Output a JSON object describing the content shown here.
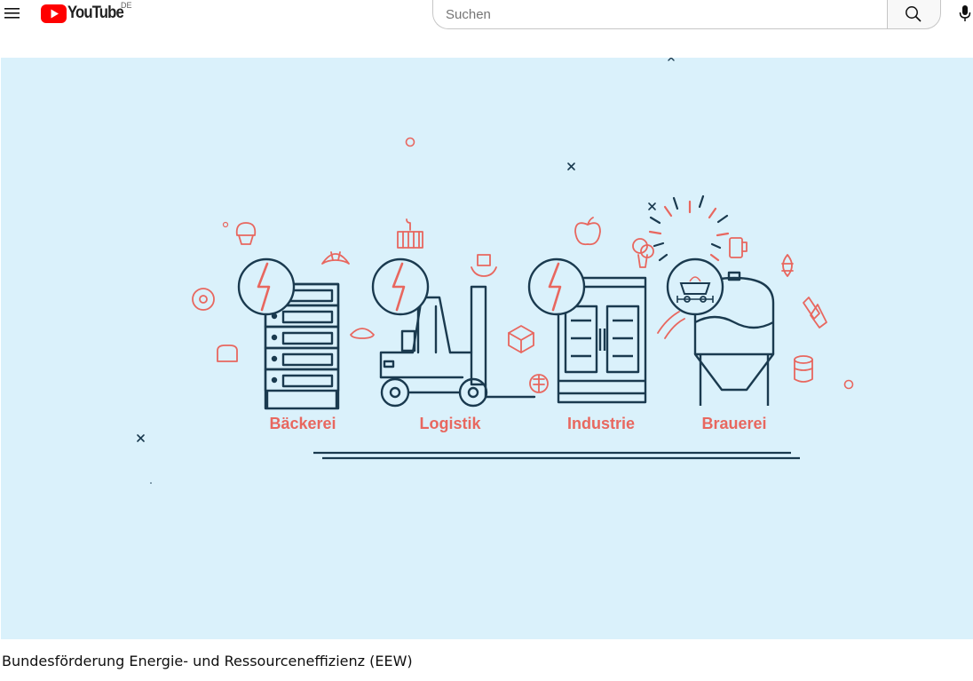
{
  "masthead": {
    "menu_icon": "hamburger-menu-icon",
    "logo_text": "YouTube",
    "country_code": "DE",
    "search_placeholder": "Suchen",
    "search_icon": "search-icon",
    "mic_icon": "microphone-icon"
  },
  "player": {
    "labels": [
      "Bäckerei",
      "Logistik",
      "Industrie",
      "Brauerei"
    ]
  },
  "video": {
    "title": "Bundesförderung Energie- und Ressourceneffizienz (EEW)"
  },
  "colors": {
    "brand_red": "#ff0000",
    "illustration_bg": "#daf1fb",
    "illustration_dark": "#1a3a4f",
    "illustration_accent": "#e8675f"
  }
}
